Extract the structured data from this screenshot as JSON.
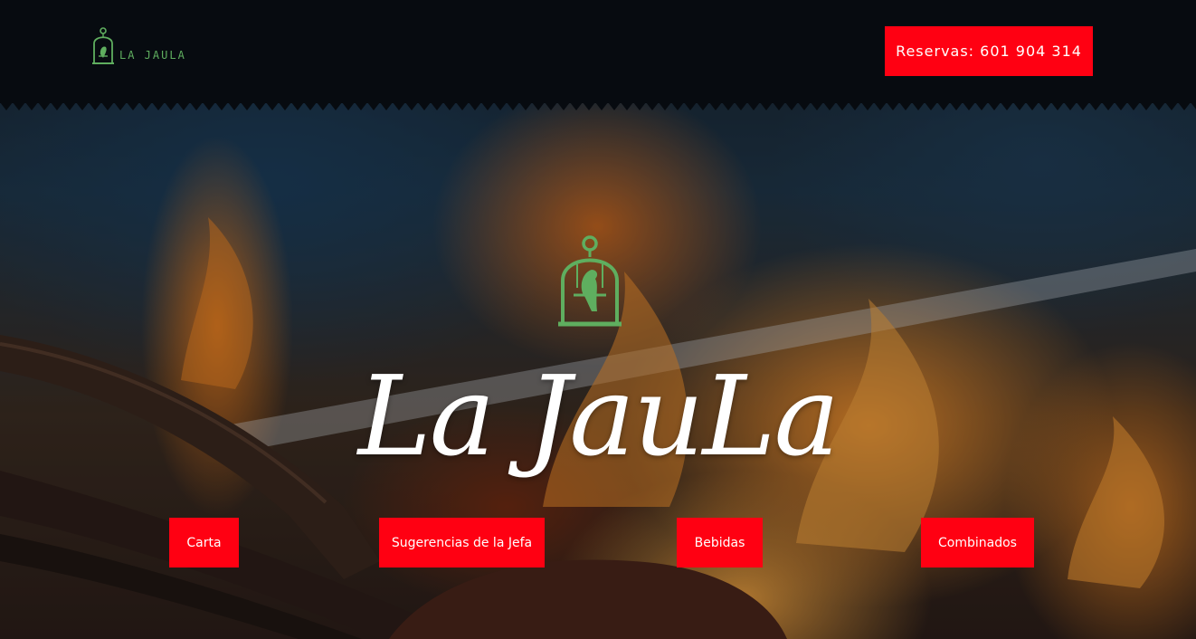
{
  "header": {
    "brand_name": "LA JAULA",
    "reserve_label": "Reservas: 601 904 314"
  },
  "hero": {
    "title": "La JauLa"
  },
  "menu": {
    "items": [
      {
        "label": "Carta"
      },
      {
        "label": "Sugerencias de la Jefa"
      },
      {
        "label": "Bebidas"
      },
      {
        "label": "Combinados"
      }
    ]
  },
  "colors": {
    "accent_red": "#ff0012",
    "logo_green": "#5fae5f",
    "header_bg": "#070b10"
  },
  "icons": {
    "logo": "birdcage-icon"
  }
}
